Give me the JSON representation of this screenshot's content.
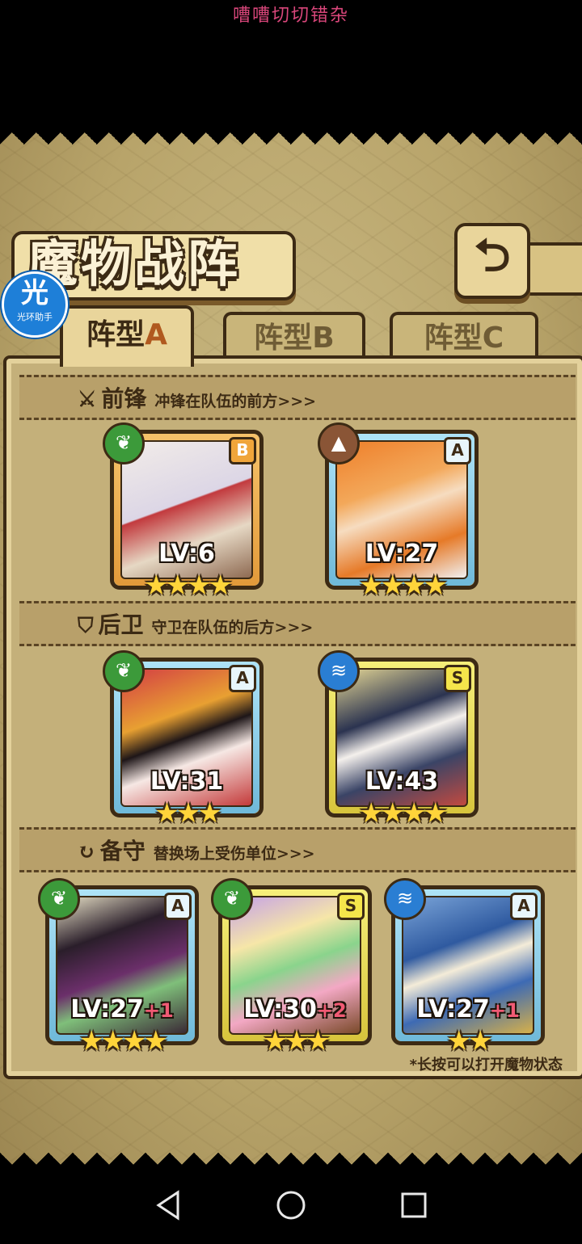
{
  "app_title": "嘈嘈切切错杂",
  "screen": {
    "title": "魔物战阵",
    "back_icon": "return-arrow-icon"
  },
  "helper": {
    "glyph": "光",
    "label": "光环助手"
  },
  "tabs": [
    {
      "label": "阵型",
      "letter": "A",
      "active": true
    },
    {
      "label": "阵型",
      "letter": "B",
      "active": false
    },
    {
      "label": "阵型",
      "letter": "C",
      "active": false
    }
  ],
  "sections": {
    "vanguard": {
      "title": "前锋",
      "subtitle": "冲锋在队伍的前方>>>",
      "icon": "sword-icon"
    },
    "rearguard": {
      "title": "后卫",
      "subtitle": "守卫在队伍的后方>>>",
      "icon": "shield-icon"
    },
    "reserve": {
      "title": "备守",
      "subtitle": "替换场上受伤单位>>>",
      "icon": "swap-icon"
    }
  },
  "cards": {
    "vanguard": [
      {
        "rank": "B",
        "element": "grass",
        "level": "LV:6",
        "plus": "",
        "stars": "★★★★"
      },
      {
        "rank": "A",
        "element": "earth",
        "level": "LV:27",
        "plus": "",
        "stars": "★★★★"
      }
    ],
    "rearguard": [
      {
        "rank": "A",
        "element": "grass",
        "level": "LV:31",
        "plus": "",
        "stars": "★★★"
      },
      {
        "rank": "S",
        "element": "water",
        "level": "LV:43",
        "plus": "",
        "stars": "★★★★"
      }
    ],
    "reserve": [
      {
        "rank": "A",
        "element": "grass",
        "level": "LV:27",
        "plus": "+1",
        "stars": "★★★★"
      },
      {
        "rank": "S",
        "element": "grass",
        "level": "LV:30",
        "plus": "+2",
        "stars": "★★★"
      },
      {
        "rank": "A",
        "element": "water",
        "level": "LV:27",
        "plus": "+1",
        "stars": "★★"
      }
    ]
  },
  "hint": "*长按可以打开魔物状态",
  "colors": {
    "frame_dark": "#3c2a14",
    "parchment": "#c4b07a",
    "rank_b": "#f0a53a",
    "rank_a": "#6fb9d9",
    "rank_s": "#d7c43c"
  }
}
